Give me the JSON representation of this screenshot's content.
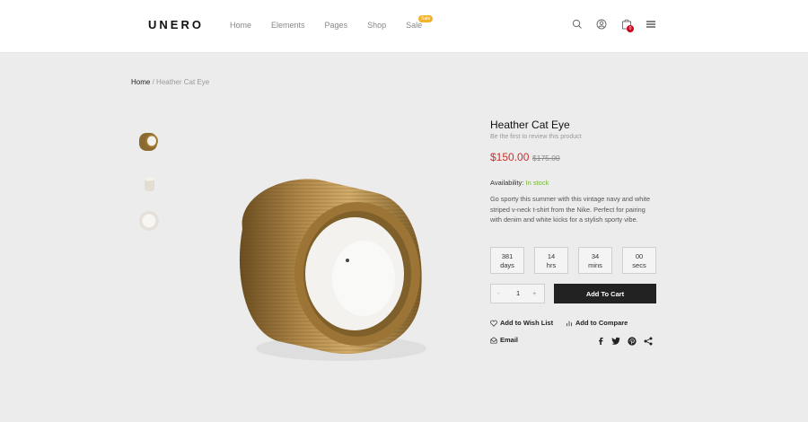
{
  "header": {
    "logo": "UNERO",
    "nav": [
      "Home",
      "Elements",
      "Pages",
      "Shop",
      "Sale"
    ],
    "sale_badge": "Sale",
    "cart_count": "0"
  },
  "breadcrumb": {
    "home": "Home",
    "sep": "/",
    "current": "Heather Cat Eye"
  },
  "product": {
    "title": "Heather Cat Eye",
    "review_text": "Be the first to review this product",
    "price": "$150.00",
    "old_price": "$175.00",
    "availability_label": "Availability:",
    "availability_value": "In stock",
    "description": "Go sporty this summer with this vintage navy and white striped v-neck t-shirt from the Nike. Perfect for pairing with denim and white kicks for a stylish sporty vibe.",
    "countdown": [
      {
        "value": "381",
        "unit": "days"
      },
      {
        "value": "14",
        "unit": "hrs"
      },
      {
        "value": "34",
        "unit": "mins"
      },
      {
        "value": "00",
        "unit": "secs"
      }
    ],
    "quantity": "1",
    "minus": "-",
    "plus": "+",
    "add_to_cart": "Add To Cart",
    "wishlist": "Add to Wish List",
    "compare": "Add to Compare",
    "email": "Email",
    "share_icons": [
      "facebook-icon",
      "twitter-icon",
      "pinterest-icon",
      "share-icon"
    ]
  },
  "colors": {
    "price": "#c9302c",
    "stock": "#77b53c",
    "button": "#222222",
    "badge": "#f1b32e"
  }
}
